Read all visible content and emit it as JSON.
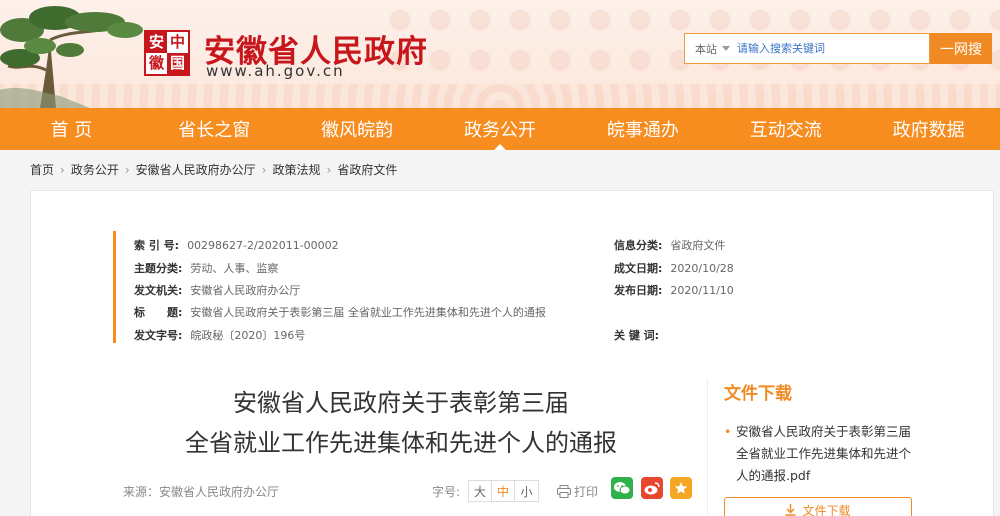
{
  "header": {
    "seal_chars": [
      "安",
      "中",
      "徽",
      "国"
    ],
    "site_title": "安徽省人民政府",
    "site_url": "www.ah.gov.cn",
    "search": {
      "scope": "本站",
      "placeholder": "请输入搜索关键词",
      "button": "一网搜"
    }
  },
  "nav": {
    "items": [
      {
        "label": "首 页"
      },
      {
        "label": "省长之窗"
      },
      {
        "label": "徽风皖韵"
      },
      {
        "label": "政务公开",
        "active": true
      },
      {
        "label": "皖事通办"
      },
      {
        "label": "互动交流"
      },
      {
        "label": "政府数据"
      }
    ]
  },
  "breadcrumb": [
    "首页",
    "政务公开",
    "安徽省人民政府办公厅",
    "政策法规",
    "省政府文件"
  ],
  "meta": {
    "index_label": "索 引 号:",
    "index_value": "00298627-2/202011-00002",
    "category_label": "信息分类:",
    "category_value": "省政府文件",
    "topic_label": "主题分类:",
    "topic_value": "劳动、人事、监察",
    "written_label": "成文日期:",
    "written_value": "2020/10/28",
    "issuer_label": "发文机关:",
    "issuer_value": "安徽省人民政府办公厅",
    "published_label": "发布日期:",
    "published_value": "2020/11/10",
    "title_label": "标　　题:",
    "title_value": "安徽省人民政府关于表彰第三届 全省就业工作先进集体和先进个人的通报",
    "docno_label": "发文字号:",
    "docno_value": "皖政秘〔2020〕196号",
    "keywords_label": "关 键 词:",
    "keywords_value": ""
  },
  "document": {
    "title_line1": "安徽省人民政府关于表彰第三届",
    "title_line2": "全省就业工作先进集体和先进个人的通报",
    "source": "来源：安徽省人民政府办公厅",
    "fontsize_label": "字号:",
    "fontsize_options": [
      "大",
      "中",
      "小"
    ],
    "print_label": "打印"
  },
  "download": {
    "heading": "文件下载",
    "file_name": "安徽省人民政府关于表彰第三届全省就业工作先进集体和先进个人的通报.pdf",
    "button": "文件下载"
  },
  "icons": {
    "wechat": "wechat-icon",
    "weibo": "weibo-icon",
    "qzone": "qzone-star-icon",
    "print": "printer-icon",
    "download": "download-arrow-icon"
  },
  "colors": {
    "accent_orange": "#f78c1f",
    "brand_red": "#c8161d"
  }
}
